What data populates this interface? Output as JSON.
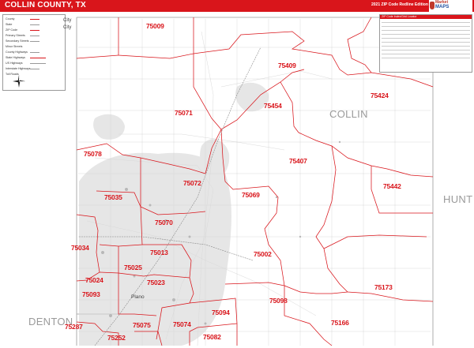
{
  "header": {
    "title": "COLLIN COUNTY, TX",
    "edition": "2021 ZIP Code Redline Edition",
    "brand_top": "MarketMAPS",
    "brand_name": "MAPS",
    "brand_small": "Market"
  },
  "legend": {
    "city_label": "City",
    "items": [
      "County",
      "State",
      "ZIP Code",
      "Primary Streets",
      "Secondary Streets",
      "Minor Streets",
      "County Highways",
      "State Highways",
      "US Highways",
      "Interstate Highways",
      "Toll Roads"
    ]
  },
  "index": {
    "heading": "ZIP Code Index/Grid Locator"
  },
  "regions": {
    "collin": "COLLIN",
    "hunt": "HUNT",
    "denton": "DENTON"
  },
  "cities": {
    "plano": "Plano"
  },
  "zips": [
    "75009",
    "75409",
    "75424",
    "75454",
    "75071",
    "75078",
    "75407",
    "75072",
    "75035",
    "75069",
    "75442",
    "75070",
    "75034",
    "75002",
    "75013",
    "75025",
    "75024",
    "75023",
    "75093",
    "75098",
    "75173",
    "75094",
    "75287",
    "75075",
    "75074",
    "75166",
    "75252",
    "75082"
  ],
  "colors": {
    "accent": "#d9151b",
    "region_text": "#9a9a9a"
  }
}
